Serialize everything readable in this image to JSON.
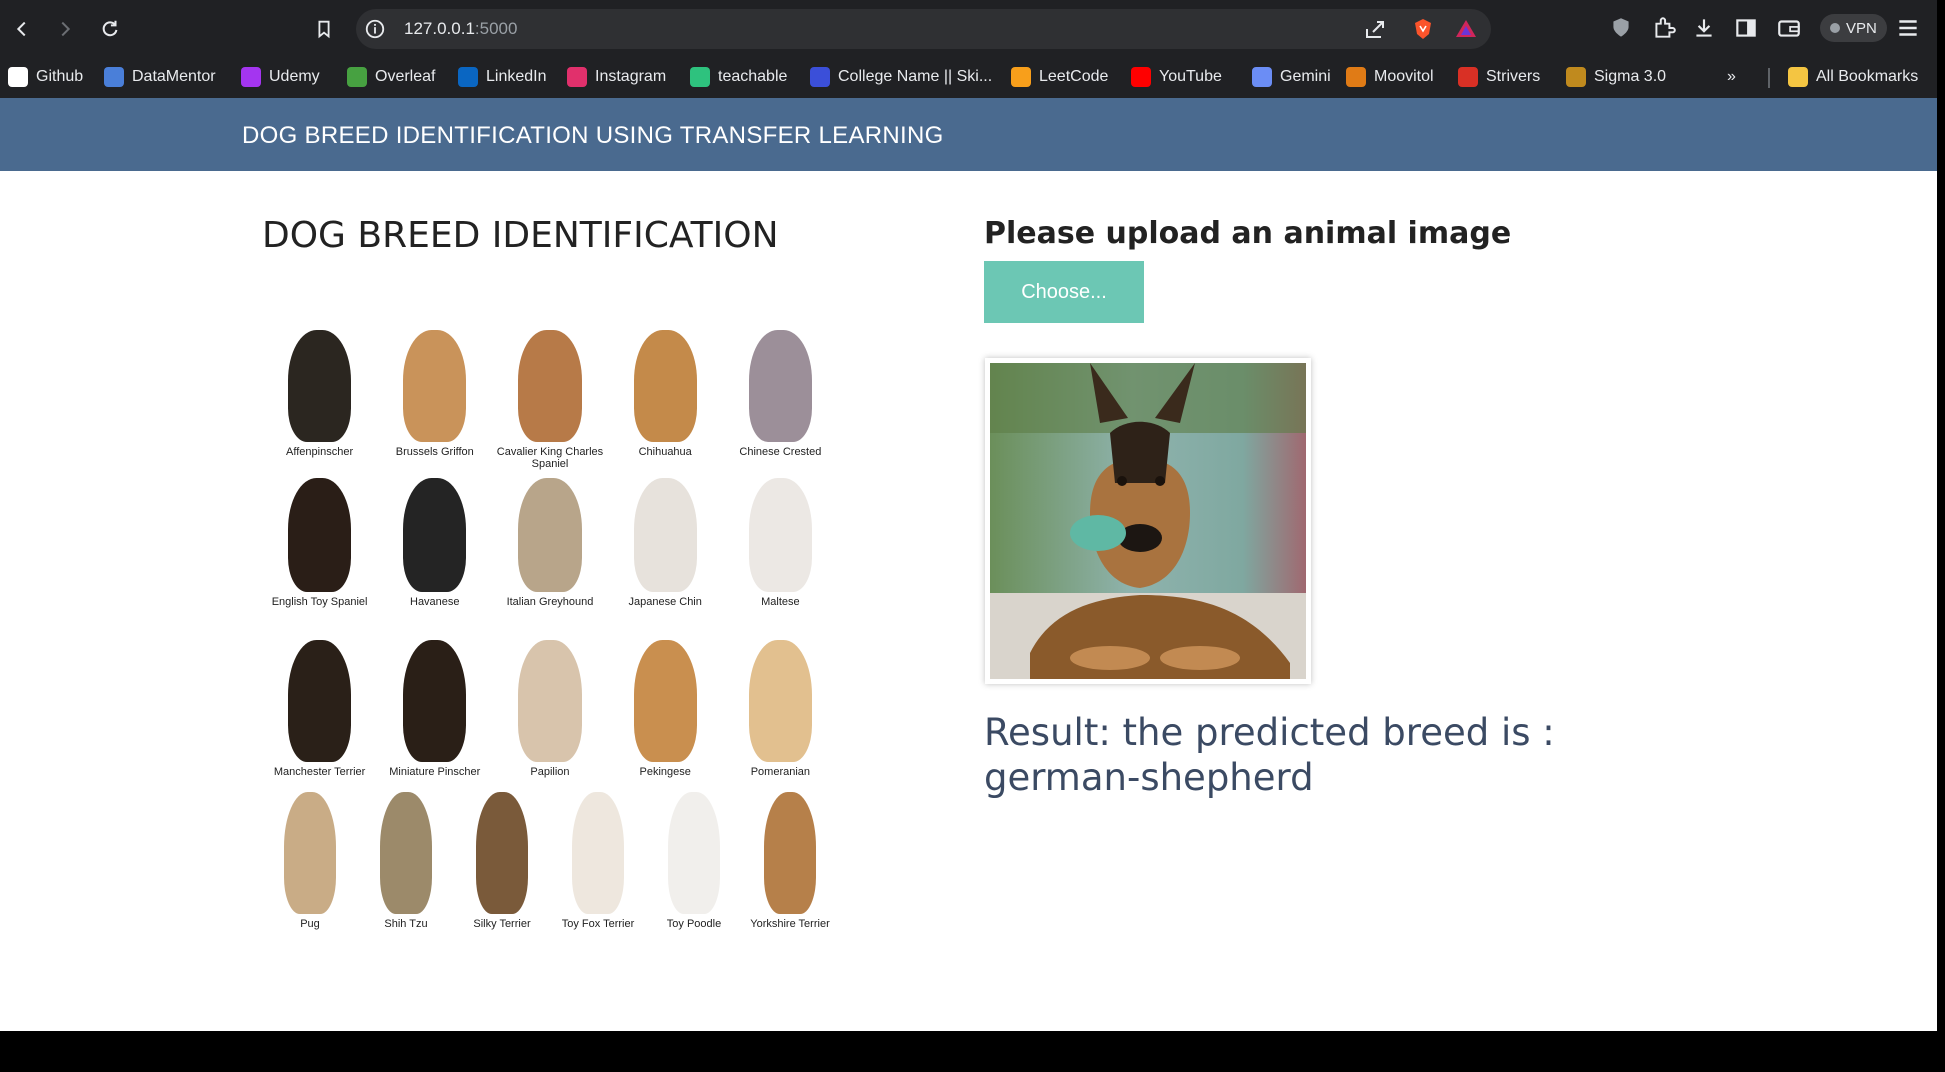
{
  "browser": {
    "url": "127.0.0.1",
    "port": ":5000",
    "vpn_label": "VPN",
    "bookmarks": [
      {
        "label": "Github",
        "color": "#ffffff"
      },
      {
        "label": "DataMentor",
        "color": "#4a7fd9"
      },
      {
        "label": "Udemy",
        "color": "#a435f0"
      },
      {
        "label": "Overleaf",
        "color": "#47a141"
      },
      {
        "label": "LinkedIn",
        "color": "#0a66c2"
      },
      {
        "label": "Instagram",
        "color": "#e1306c"
      },
      {
        "label": "teachable",
        "color": "#2ec27e"
      },
      {
        "label": "College Name || Ski...",
        "color": "#3b4fd9"
      },
      {
        "label": "LeetCode",
        "color": "#f89f1b"
      },
      {
        "label": "YouTube",
        "color": "#ff0000"
      },
      {
        "label": "Gemini",
        "color": "#6b8df5"
      },
      {
        "label": "Moovitol",
        "color": "#e07b16"
      },
      {
        "label": "Strivers",
        "color": "#d93025"
      },
      {
        "label": "Sigma 3.0",
        "color": "#c08a1e"
      }
    ],
    "more_label": "»",
    "all_bookmarks_label": "All Bookmarks"
  },
  "app": {
    "brand": "DOG BREED IDENTIFICATION USING TRANSFER LEARNING",
    "left_title": "DOG BREED IDENTIFICATION",
    "upload_title": "Please upload an animal image",
    "choose_label": "Choose...",
    "result_text": "Result: the predicted breed is : german-shepherd",
    "accent_color": "#6cc7b4",
    "header_color": "#4a6a8f"
  },
  "breeds": [
    [
      "Affenpinscher",
      "Brussels Griffon",
      "Cavalier King Charles Spaniel",
      "Chihuahua",
      "Chinese Crested"
    ],
    [
      "English Toy Spaniel",
      "Havanese",
      "Italian Greyhound",
      "Japanese Chin",
      "Maltese"
    ],
    [
      "Manchester Terrier",
      "Miniature Pinscher",
      "Papilion",
      "Pekingese",
      "Pomeranian"
    ],
    [
      "Pug",
      "Shih Tzu",
      "Silky Terrier",
      "Toy Fox Terrier",
      "Toy Poodle",
      "Yorkshire Terrier"
    ]
  ]
}
